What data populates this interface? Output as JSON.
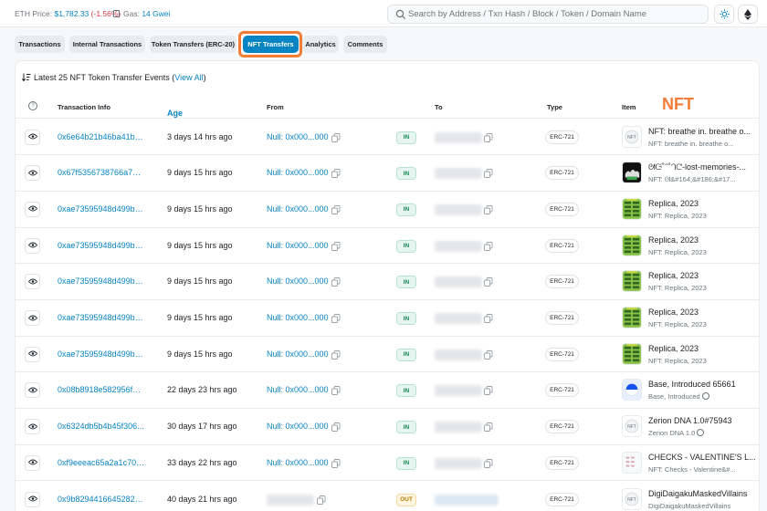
{
  "topbar": {
    "eth_price_label": "ETH Price:",
    "eth_price_value": "$1,782.33",
    "eth_price_change": "(-1.56%)",
    "gas_label": "Gas:",
    "gas_value": "14 Gwei",
    "search_placeholder": "Search by Address / Txn Hash / Block / Token / Domain Name"
  },
  "tabs": [
    "Transactions",
    "Internal Transactions",
    "Token Transfers (ERC-20)",
    "NFT Transfers",
    "Analytics",
    "Comments"
  ],
  "active_tab": "NFT Transfers",
  "summary": {
    "text": "Latest 25 NFT Token Transfer Events (",
    "link": "View All",
    "close": ")"
  },
  "annotation": "NFT",
  "columns": {
    "tx_info": "Transaction Info",
    "age": "Age",
    "from": "From",
    "to": "To",
    "type": "Type",
    "item": "Item"
  },
  "rows": [
    {
      "hash": "0x6e64b21b46ba41b7...",
      "age": "3 days 14 hrs ago",
      "from": "Null: 0x000...000",
      "dir": "IN",
      "type": "ERC-721",
      "title": "NFT: breathe in. breathe o...",
      "sub": "NFT: breathe in. breathe o...",
      "thumb": "nft-placeholder"
    },
    {
      "hash": "0x67f5356738766a76b...",
      "age": "9 days 15 hrs ago",
      "from": "Null: 0x000...000",
      "dir": "IN",
      "type": "ERC-721",
      "title": "ᘛᙍ˚ᐢ˚ᘃᘧ-lost-memories-...",
      "sub": "NFT: ᘛ&#164;&#186;&#17...",
      "thumb": "dark-art"
    },
    {
      "hash": "0xae73595948d499b2...",
      "age": "9 days 15 hrs ago",
      "from": "Null: 0x000...000",
      "dir": "IN",
      "type": "ERC-721",
      "title": "Replica, 2023",
      "sub": "NFT: Replica, 2023",
      "thumb": "replica"
    },
    {
      "hash": "0xae73595948d499b2...",
      "age": "9 days 15 hrs ago",
      "from": "Null: 0x000...000",
      "dir": "IN",
      "type": "ERC-721",
      "title": "Replica, 2023",
      "sub": "NFT: Replica, 2023",
      "thumb": "replica"
    },
    {
      "hash": "0xae73595948d499b2...",
      "age": "9 days 15 hrs ago",
      "from": "Null: 0x000...000",
      "dir": "IN",
      "type": "ERC-721",
      "title": "Replica, 2023",
      "sub": "NFT: Replica, 2023",
      "thumb": "replica"
    },
    {
      "hash": "0xae73595948d499b2...",
      "age": "9 days 15 hrs ago",
      "from": "Null: 0x000...000",
      "dir": "IN",
      "type": "ERC-721",
      "title": "Replica, 2023",
      "sub": "NFT: Replica, 2023",
      "thumb": "replica"
    },
    {
      "hash": "0xae73595948d499b2...",
      "age": "9 days 15 hrs ago",
      "from": "Null: 0x000...000",
      "dir": "IN",
      "type": "ERC-721",
      "title": "Replica, 2023",
      "sub": "NFT: Replica, 2023",
      "thumb": "replica"
    },
    {
      "hash": "0x08b8918e582956f09...",
      "age": "22 days 23 hrs ago",
      "from": "Null: 0x000...000",
      "dir": "IN",
      "type": "ERC-721",
      "title": "Base, Introduced 65661",
      "sub": "Base, Introduced",
      "thumb": "base",
      "verified": true
    },
    {
      "hash": "0x6324db5b4b45f306...",
      "age": "30 days 17 hrs ago",
      "from": "Null: 0x000...000",
      "dir": "IN",
      "type": "ERC-721",
      "title": "Zerion DNA 1.0#75943",
      "sub": "Zerion DNA 1.0",
      "thumb": "nft-placeholder",
      "verified": true
    },
    {
      "hash": "0xf9eeeac65a2a1c702...",
      "age": "33 days 22 hrs ago",
      "from": "Null: 0x000...000",
      "dir": "IN",
      "type": "ERC-721",
      "title": "CHECKS - VALENTINE'S L...",
      "sub": "NFT: Checks - Valentine&#...",
      "thumb": "checks"
    },
    {
      "hash": "0x9b82944166452823...",
      "age": "40 days 21 hrs ago",
      "from": "",
      "dir": "OUT",
      "type": "ERC-721",
      "title": "DigiDaigakuMaskedVillains",
      "sub": "DigiDaigakuMaskedVillains",
      "thumb": "nft-placeholder"
    }
  ],
  "colors": {
    "accent": "#0784c3",
    "highlight": "#f47c34",
    "in": "#198754",
    "out": "#b47d00"
  }
}
